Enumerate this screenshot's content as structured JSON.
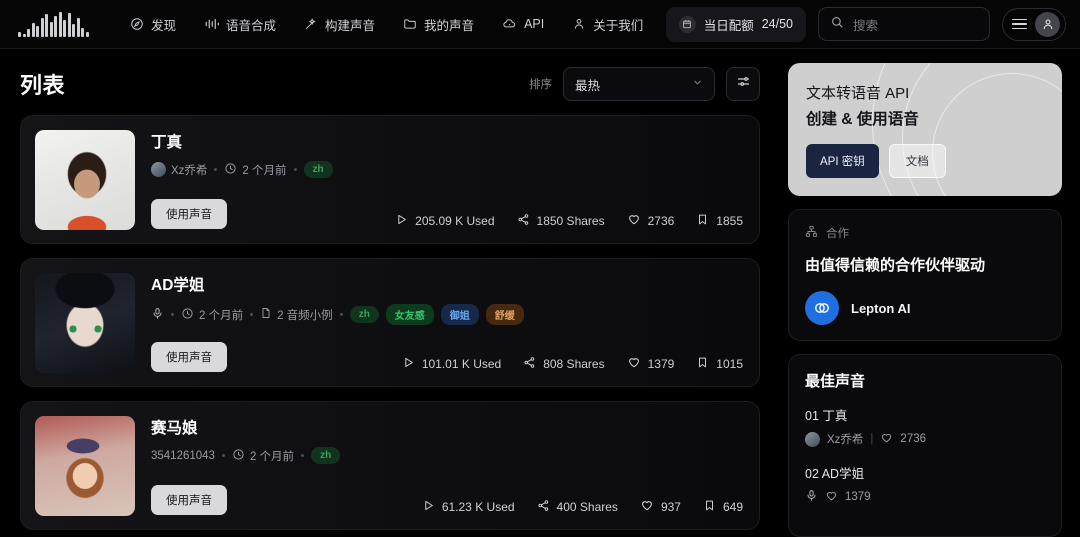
{
  "nav": {
    "logo_name": "waveform-logo",
    "items": [
      {
        "label": "发现",
        "icon": "compass-icon"
      },
      {
        "label": "语音合成",
        "icon": "waveform-icon"
      },
      {
        "label": "构建声音",
        "icon": "magic-wand-icon"
      },
      {
        "label": "我的声音",
        "icon": "folder-icon"
      },
      {
        "label": "API",
        "icon": "cloud-icon"
      },
      {
        "label": "关于我们",
        "icon": "people-icon"
      }
    ],
    "quota": {
      "label": "当日配额",
      "value": "24/50",
      "icon": "calendar-icon"
    },
    "search": {
      "placeholder": "搜索",
      "icon": "search-icon"
    },
    "menu_icon": "hamburger-icon",
    "avatar_icon": "user-avatar-icon"
  },
  "list": {
    "title": "列表",
    "sort_label": "排序",
    "sort_value": "最热",
    "filter_icon": "filter-sliders-icon",
    "use_button_label": "使用声音",
    "cards": [
      {
        "title": "丁真",
        "author": "Xz乔希",
        "time": "2 个月前",
        "samples": null,
        "tags": [
          {
            "text": "zh",
            "color": "#3ea05f",
            "bg": "#12331d"
          }
        ],
        "used": "205.09 K Used",
        "shares": "1850 Shares",
        "likes": "2736",
        "saves": "1855",
        "thumb": "portrait-ding-zhen"
      },
      {
        "title": "AD学姐",
        "author": null,
        "time": "2 个月前",
        "samples": "2 音频小例",
        "tags": [
          {
            "text": "zh",
            "color": "#3ea05f",
            "bg": "#12331d"
          },
          {
            "text": "女友感",
            "color": "#35c46a",
            "bg": "#0e3a1e"
          },
          {
            "text": "御姐",
            "color": "#6aa6ee",
            "bg": "#16294a"
          },
          {
            "text": "舒缓",
            "color": "#e0a060",
            "bg": "#46290f"
          }
        ],
        "used": "101.01 K Used",
        "shares": "808 Shares",
        "likes": "1379",
        "saves": "1015",
        "thumb": "anime-ad-senpai"
      },
      {
        "title": "赛马娘",
        "author": "3541261043",
        "time": "2 个月前",
        "samples": null,
        "tags": [
          {
            "text": "zh",
            "color": "#3ea05f",
            "bg": "#12331d"
          }
        ],
        "used": "61.23 K Used",
        "shares": "400 Shares",
        "likes": "937",
        "saves": "649",
        "thumb": "anime-uma-musume"
      }
    ]
  },
  "rail": {
    "promo": {
      "line1": "文本转语音 API",
      "line2": "创建 & 使用语音",
      "primary_button": "API 密钥",
      "secondary_button": "文档"
    },
    "partners": {
      "label": "合作",
      "label_icon": "network-icon",
      "headline": "由值得信赖的合作伙伴驱动",
      "items": [
        {
          "name": "Lepton AI",
          "logo": "lepton-logo"
        }
      ]
    },
    "best_voices": {
      "title": "最佳声音",
      "items": [
        {
          "rank": "01",
          "name": "丁真",
          "author": "Xz乔希",
          "likes": "2736",
          "thumb": "portrait-ding-zhen"
        },
        {
          "rank": "02",
          "name": "AD学姐",
          "author": null,
          "likes": "1379",
          "thumb": "anime-ad-senpai"
        }
      ]
    }
  },
  "colors": {
    "background": "#000000",
    "accent_green": "#3ea05f",
    "partner_blue": "#1f6fe0",
    "button_light": "#d9d9dd"
  }
}
